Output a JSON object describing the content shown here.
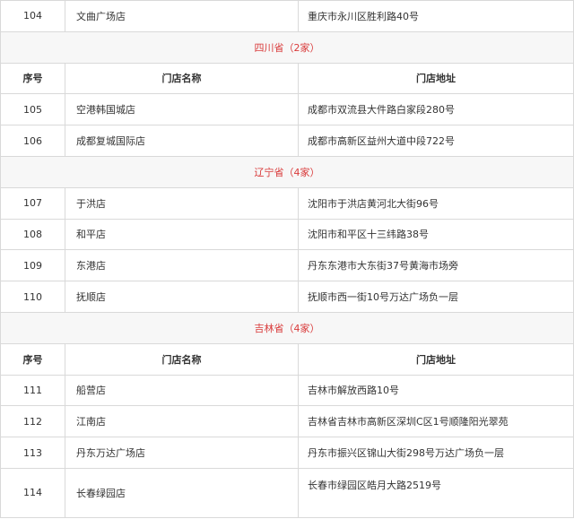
{
  "colors": {
    "region_title": "#d93a3a",
    "region_bg": "#f7f7f7",
    "border": "#d9d9d9"
  },
  "columns": {
    "no": "序号",
    "name": "门店名称",
    "addr": "门店地址"
  },
  "first_row": {
    "no": "104",
    "name": "文曲广场店",
    "addr": "重庆市永川区胜利路40号"
  },
  "regions": [
    {
      "title": "四川省（2家）",
      "rows": [
        {
          "no": "105",
          "name": "空港韩国城店",
          "addr": "成都市双流县大件路白家段280号"
        },
        {
          "no": "106",
          "name": "成都复城国际店",
          "addr": "成都市高新区益州大道中段722号"
        }
      ]
    },
    {
      "title": "辽宁省（4家）",
      "rows": [
        {
          "no": "107",
          "name": "于洪店",
          "addr": "沈阳市于洪店黄河北大街96号"
        },
        {
          "no": "108",
          "name": "和平店",
          "addr": "沈阳市和平区十三纬路38号"
        },
        {
          "no": "109",
          "name": "东港店",
          "addr": "丹东东港市大东街37号黄海市场旁"
        },
        {
          "no": "110",
          "name": "抚顺店",
          "addr": "抚顺市西一街10号万达广场负一层"
        }
      ]
    },
    {
      "title": "吉林省（4家）",
      "rows": [
        {
          "no": "111",
          "name": "船营店",
          "addr": "吉林市解放西路10号"
        },
        {
          "no": "112",
          "name": "江南店",
          "addr": "吉林省吉林市高新区深圳C区1号顺隆阳光翠苑"
        },
        {
          "no": "113",
          "name": "丹东万达广场店",
          "addr": "丹东市振兴区锦山大街298号万达广场负一层"
        },
        {
          "no": "114",
          "name": "长春绿园店",
          "addr": "长春市绿园区皓月大路2519号"
        }
      ]
    }
  ]
}
